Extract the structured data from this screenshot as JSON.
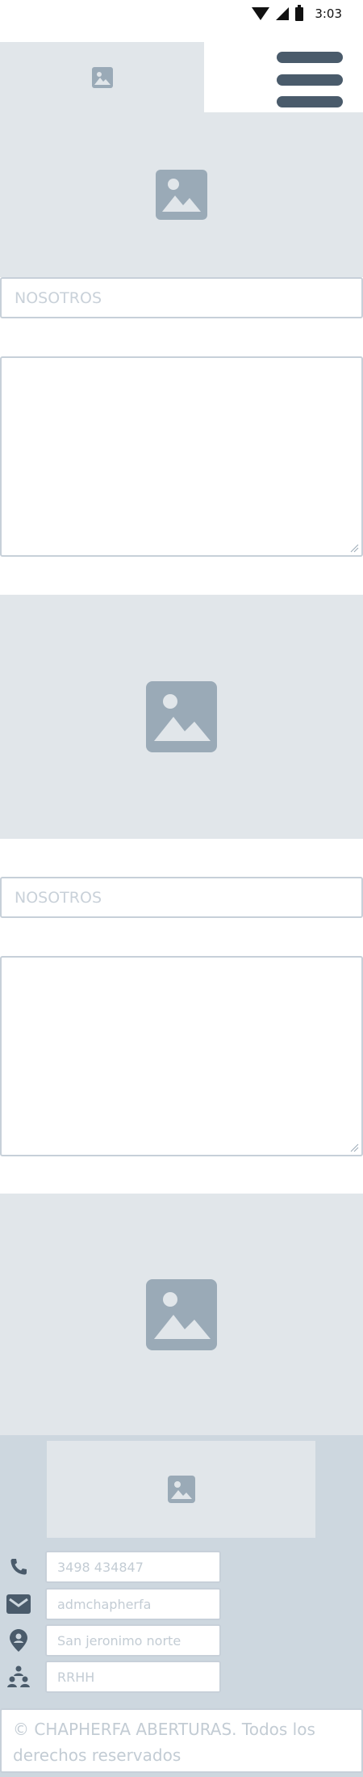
{
  "status_bar": {
    "time": "3:03",
    "icons": [
      "wifi-icon",
      "cell-signal-icon",
      "battery-icon"
    ]
  },
  "header": {
    "logo_icon": "image-placeholder-icon",
    "menu_icon": "hamburger-menu-icon"
  },
  "sections": [
    {
      "image_icon": "image-placeholder-icon",
      "title_value": "NOSOTROS",
      "text_value": ""
    },
    {
      "image_icon": "image-placeholder-icon",
      "title_value": "NOSOTROS",
      "text_value": ""
    }
  ],
  "bottom_image": {
    "icon": "image-placeholder-icon"
  },
  "footer": {
    "logo_icon": "image-placeholder-icon",
    "contacts": [
      {
        "icon": "phone-icon",
        "value": "3498 434847"
      },
      {
        "icon": "mail-icon",
        "value": "admchapherfa"
      },
      {
        "icon": "location-pin-icon",
        "value": "San jeronimo norte"
      },
      {
        "icon": "people-icon",
        "value": "RRHH"
      }
    ],
    "copyright": "© CHAPHERFA ABERTURAS. Todos los derechos reservados"
  },
  "colors": {
    "placeholder_bg": "#e1e6ea",
    "placeholder_icon": "#9aaab7",
    "footer_bg": "#cdd7df",
    "menu_bar": "#4a5b6b",
    "field_border": "#c7d0d9",
    "field_text": "#c3ccd4"
  }
}
